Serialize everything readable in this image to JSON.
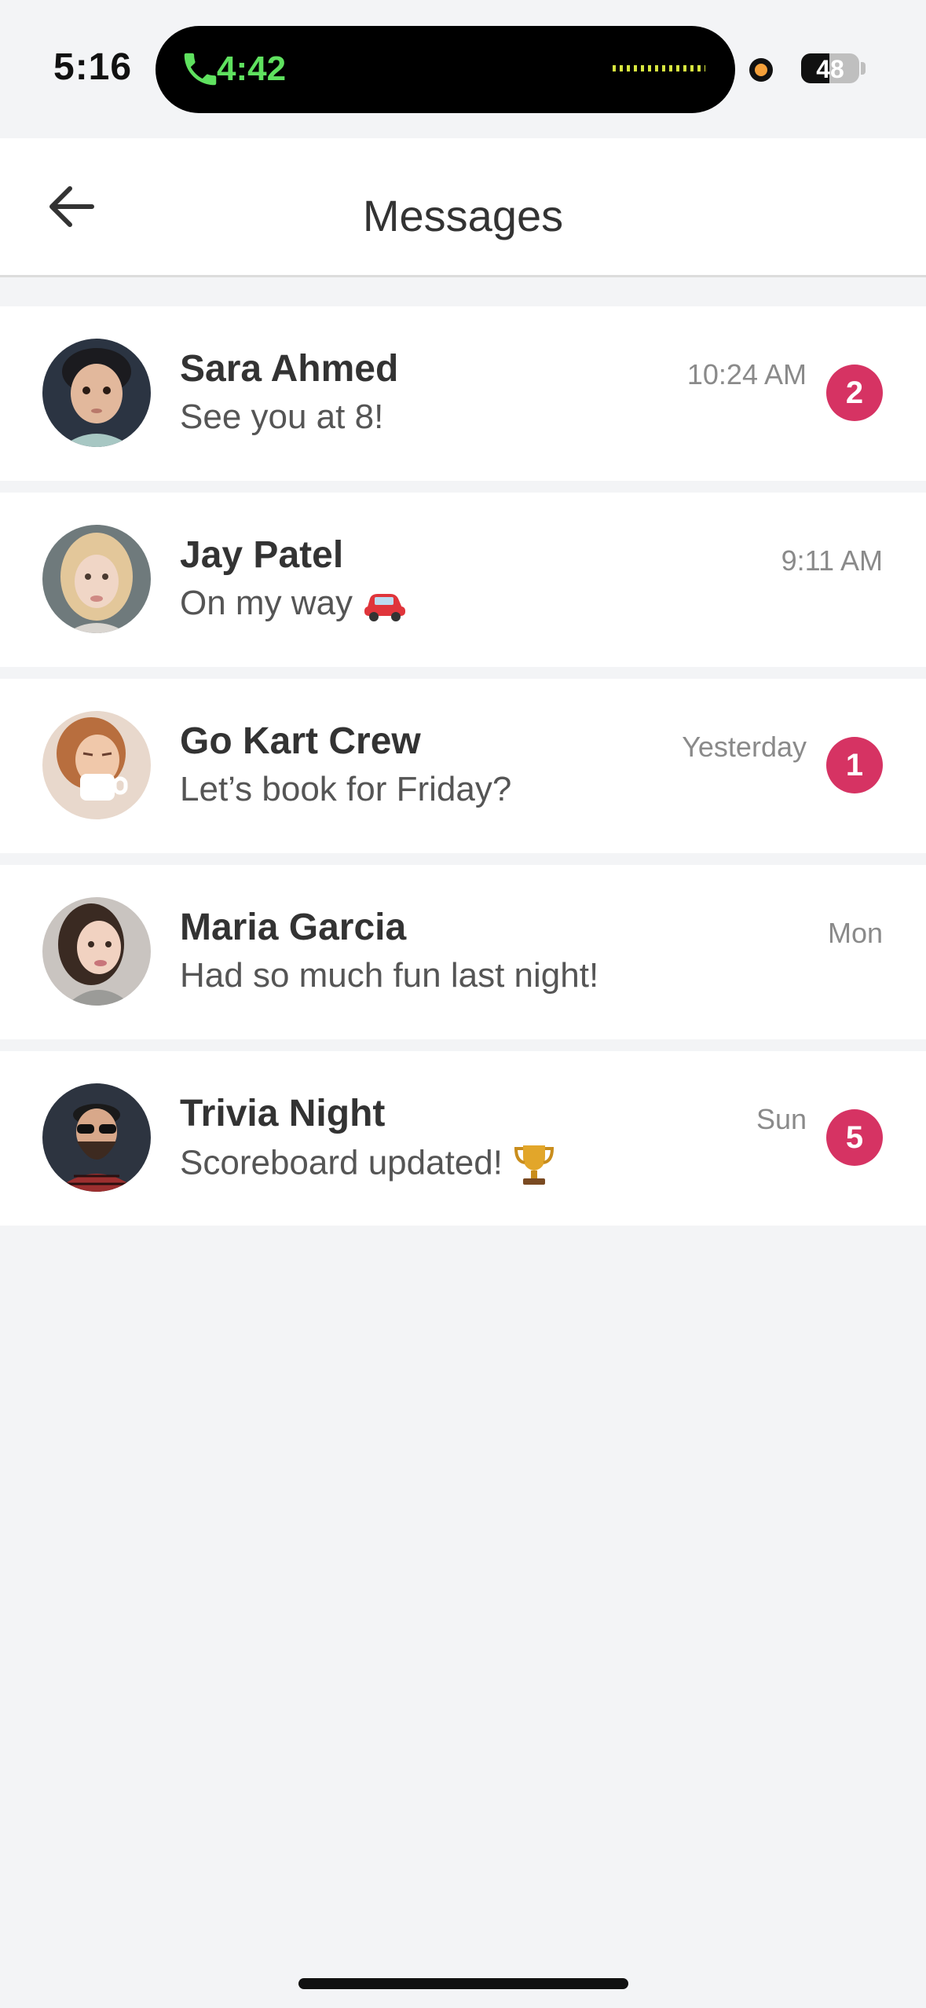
{
  "status_bar": {
    "time": "5:16",
    "call_time": "4:42",
    "battery": "48",
    "battery_level": 0.48,
    "colors": {
      "call": "#5fe15f",
      "recording": "#f5a03a"
    }
  },
  "header": {
    "title": "Messages",
    "back_icon": "arrow-left-icon"
  },
  "conversations": [
    {
      "name": "Sara Ahmed",
      "preview": "See you at 8!",
      "time": "10:24 AM",
      "unread": "2",
      "avatar": "child-portrait"
    },
    {
      "name": "Jay Patel",
      "preview": "On my way",
      "preview_emoji": "car-emoji",
      "time": "9:11 AM",
      "unread": "",
      "avatar": "blonde-portrait"
    },
    {
      "name": "Go Kart Crew",
      "preview": "Let’s book for Friday?",
      "time": "Yesterday",
      "unread": "1",
      "avatar": "coffee-portrait"
    },
    {
      "name": "Maria Garcia",
      "preview": "Had so much fun last night!",
      "time": "Mon",
      "unread": "",
      "avatar": "woman-portrait"
    },
    {
      "name": "Trivia Night",
      "preview": "Scoreboard updated!",
      "preview_emoji": "trophy-emoji",
      "time": "Sun",
      "unread": "5",
      "avatar": "bearded-man-portrait"
    }
  ],
  "colors": {
    "badge": "#d63363",
    "background": "#f3f4f6"
  }
}
